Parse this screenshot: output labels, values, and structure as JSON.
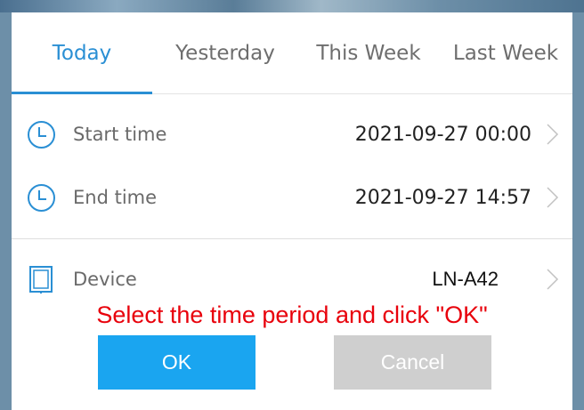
{
  "tabs": [
    {
      "label": "Today",
      "active": true
    },
    {
      "label": "Yesterday",
      "active": false
    },
    {
      "label": "This Week",
      "active": false
    },
    {
      "label": "Last Week",
      "active": false
    }
  ],
  "rows": {
    "start": {
      "label": "Start time",
      "value": "2021-09-27 00:00",
      "icon": "clock-icon"
    },
    "end": {
      "label": "End time",
      "value": "2021-09-27 14:57",
      "icon": "clock-icon"
    },
    "device": {
      "label": "Device",
      "value": "LN-A42",
      "icon": "tablet-icon"
    }
  },
  "instruction": "Select the time period and click \"OK\"",
  "buttons": {
    "ok": "OK",
    "cancel": "Cancel"
  },
  "colors": {
    "accent": "#2a8fd4",
    "ok_button": "#1aa5f0",
    "cancel_button": "#cfcfcf",
    "instruction_text": "#e8000b"
  }
}
